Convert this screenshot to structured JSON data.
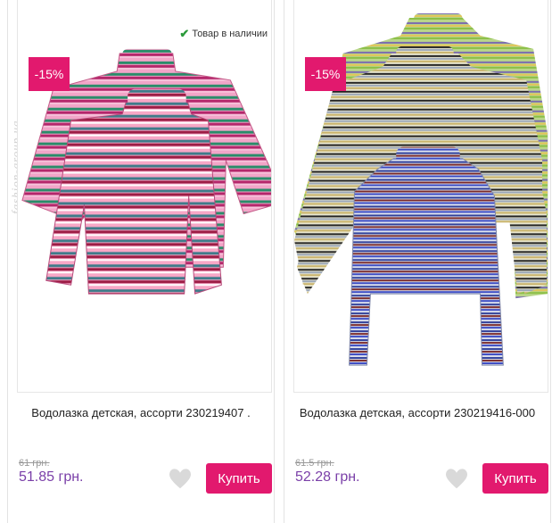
{
  "watermark": "fashion-group.ua",
  "products": [
    {
      "discount": "-15%",
      "stock": "Товар в наличии",
      "title": "Водолазка детская, ассорти 230219407 .",
      "old_price": "61 грн.",
      "new_price": "51.85 грн.",
      "buy_label": "Купить"
    },
    {
      "discount": "-15%",
      "title": "Водолазка детская, ассорти 230219416-000",
      "old_price": "61.5 грн.",
      "new_price": "52.28 грн.",
      "buy_label": "Купить"
    }
  ],
  "colors": {
    "accent": "#e2196e",
    "price": "#7a3fa8",
    "stock_tick": "#2b9a3a"
  }
}
